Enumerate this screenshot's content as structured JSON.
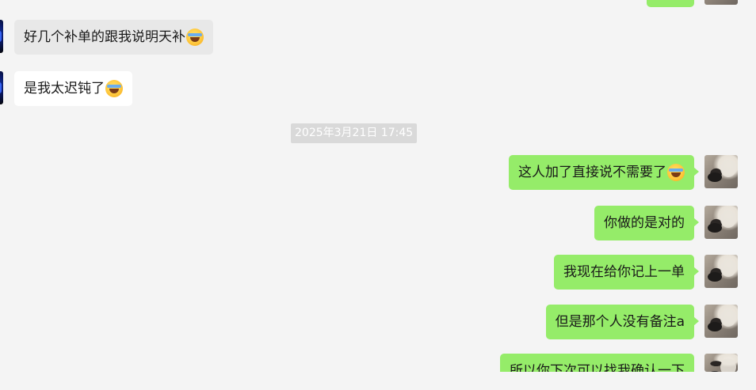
{
  "chat": {
    "messages": [
      {
        "side": "left",
        "text": "好几个补单的跟我说明天补",
        "emoji": "laugh-tears-emoji",
        "bubble": "gray"
      },
      {
        "side": "left",
        "text": "是我太迟钝了",
        "emoji": "laugh-tears-emoji",
        "bubble": "white"
      },
      {
        "side": "right",
        "text": "这人加了直接说不需要了",
        "emoji": "laugh-tears-emoji"
      },
      {
        "side": "right",
        "text": "你做的是对的"
      },
      {
        "side": "right",
        "text": "我现在给你记上一单"
      },
      {
        "side": "right",
        "text": "但是那个人没有备注a"
      },
      {
        "side": "right",
        "text": "所以你下次可以找我确认一下"
      }
    ],
    "timestamp": "2025年3月21日 17:45"
  },
  "colors": {
    "background": "#f4f4f4",
    "sent_bubble": "#95ec69",
    "received_bubble_gray": "#e8e8e8",
    "received_bubble_white": "#ffffff",
    "timestamp_bg": "#d9d9d9"
  }
}
